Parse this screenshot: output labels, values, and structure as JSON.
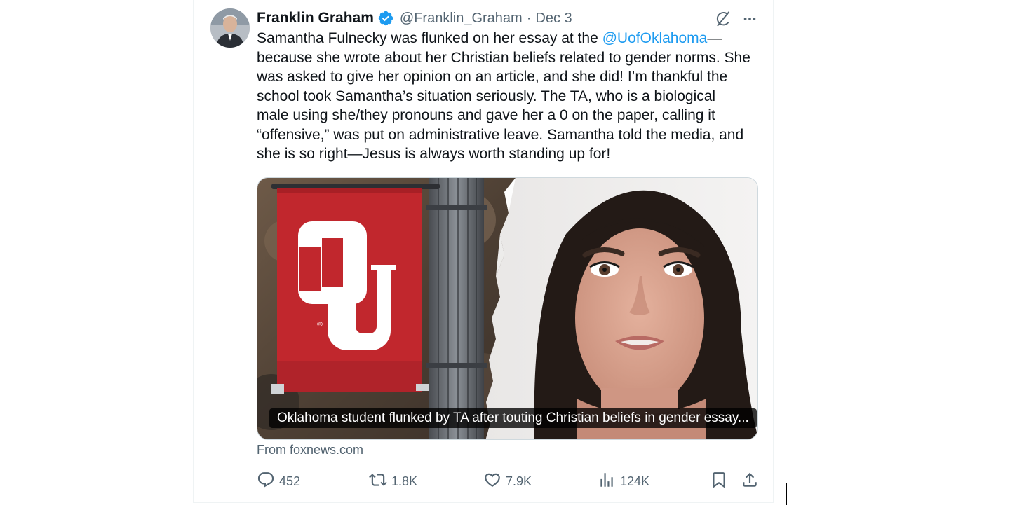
{
  "tweet": {
    "author_name": "Franklin Graham",
    "author_handle": "@Franklin_Graham",
    "separator": "·",
    "date": "Dec 3",
    "text_before_mention": "Samantha Fulnecky was flunked on her essay at the ",
    "mention": "@UofOklahoma",
    "text_after_mention": "—\nbecause she wrote about her Christian beliefs related to gender norms. She\nwas asked to give her opinion on an article, and she did! I’m thankful the\nschool took Samantha’s situation seriously. The TA, who is a biological\nmale using she/they pronouns and gave her a 0 on the paper, calling it\n“offensive,” was put on administrative leave. Samantha told the media, and\nshe is so right—Jesus is always worth standing up for!",
    "media_caption": "Oklahoma student flunked by TA after touting Christian beliefs in gender essay...",
    "source": "From foxnews.com"
  },
  "actions": {
    "replies": "452",
    "reposts": "1.8K",
    "likes": "7.9K",
    "views": "124K"
  },
  "colors": {
    "link": "#1d9bf0",
    "verified": "#1d9bf0",
    "ou_crimson": "#c1272d",
    "secondary_text": "#536471"
  },
  "icons": [
    "verified-icon",
    "grok-icon",
    "more-icon",
    "reply-icon",
    "repost-icon",
    "like-icon",
    "views-icon",
    "bookmark-icon",
    "share-icon"
  ]
}
